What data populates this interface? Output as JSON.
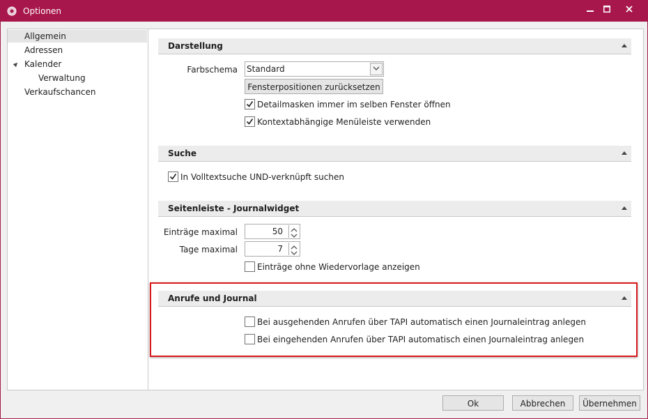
{
  "window": {
    "title": "Optionen",
    "accent_color": "#a8174b"
  },
  "titlebar_buttons": [
    {
      "name": "minimize",
      "icon": "minimize-icon"
    },
    {
      "name": "maximize",
      "icon": "maximize-icon"
    },
    {
      "name": "close",
      "icon": "close-icon"
    }
  ],
  "sidebar": {
    "items": [
      {
        "label": "Allgemein",
        "selected": true,
        "expanded": false
      },
      {
        "label": "Adressen"
      },
      {
        "label": "Kalender",
        "expanded": true
      },
      {
        "label": "Verwaltung"
      },
      {
        "label": "Verkaufschancen"
      }
    ]
  },
  "sections": {
    "darstellung": {
      "title": "Darstellung",
      "farbschema_label": "Farbschema",
      "farbschema_value": "Standard",
      "reset_button": "Fensterpositionen zurücksetzen",
      "checkboxes": [
        {
          "label": "Detailmasken immer im selben Fenster öffnen",
          "checked": true
        },
        {
          "label": "Kontextabhängige Menüleiste verwenden",
          "checked": true
        }
      ]
    },
    "suche": {
      "title": "Suche",
      "checkboxes": [
        {
          "label": "In Volltextsuche UND-verknüpft suchen",
          "checked": true
        }
      ]
    },
    "seitenleiste": {
      "title": "Seitenleiste - Journalwidget",
      "eintraege_label": "Einträge maximal",
      "eintraege_value": "50",
      "tage_label": "Tage maximal",
      "tage_value": "7",
      "checkboxes": [
        {
          "label": "Einträge ohne Wiedervorlage anzeigen",
          "checked": false
        }
      ]
    },
    "anrufe": {
      "title": "Anrufe und Journal",
      "highlight_color": "#d9191c",
      "checkboxes": [
        {
          "label": "Bei ausgehenden Anrufen über TAPI automatisch einen Journaleintrag anlegen",
          "checked": false
        },
        {
          "label": "Bei eingehenden Anrufen über TAPI automatisch einen Journaleintrag anlegen",
          "checked": false
        }
      ]
    }
  },
  "footer": {
    "ok": "Ok",
    "cancel": "Abbrechen",
    "apply": "Übernehmen"
  }
}
